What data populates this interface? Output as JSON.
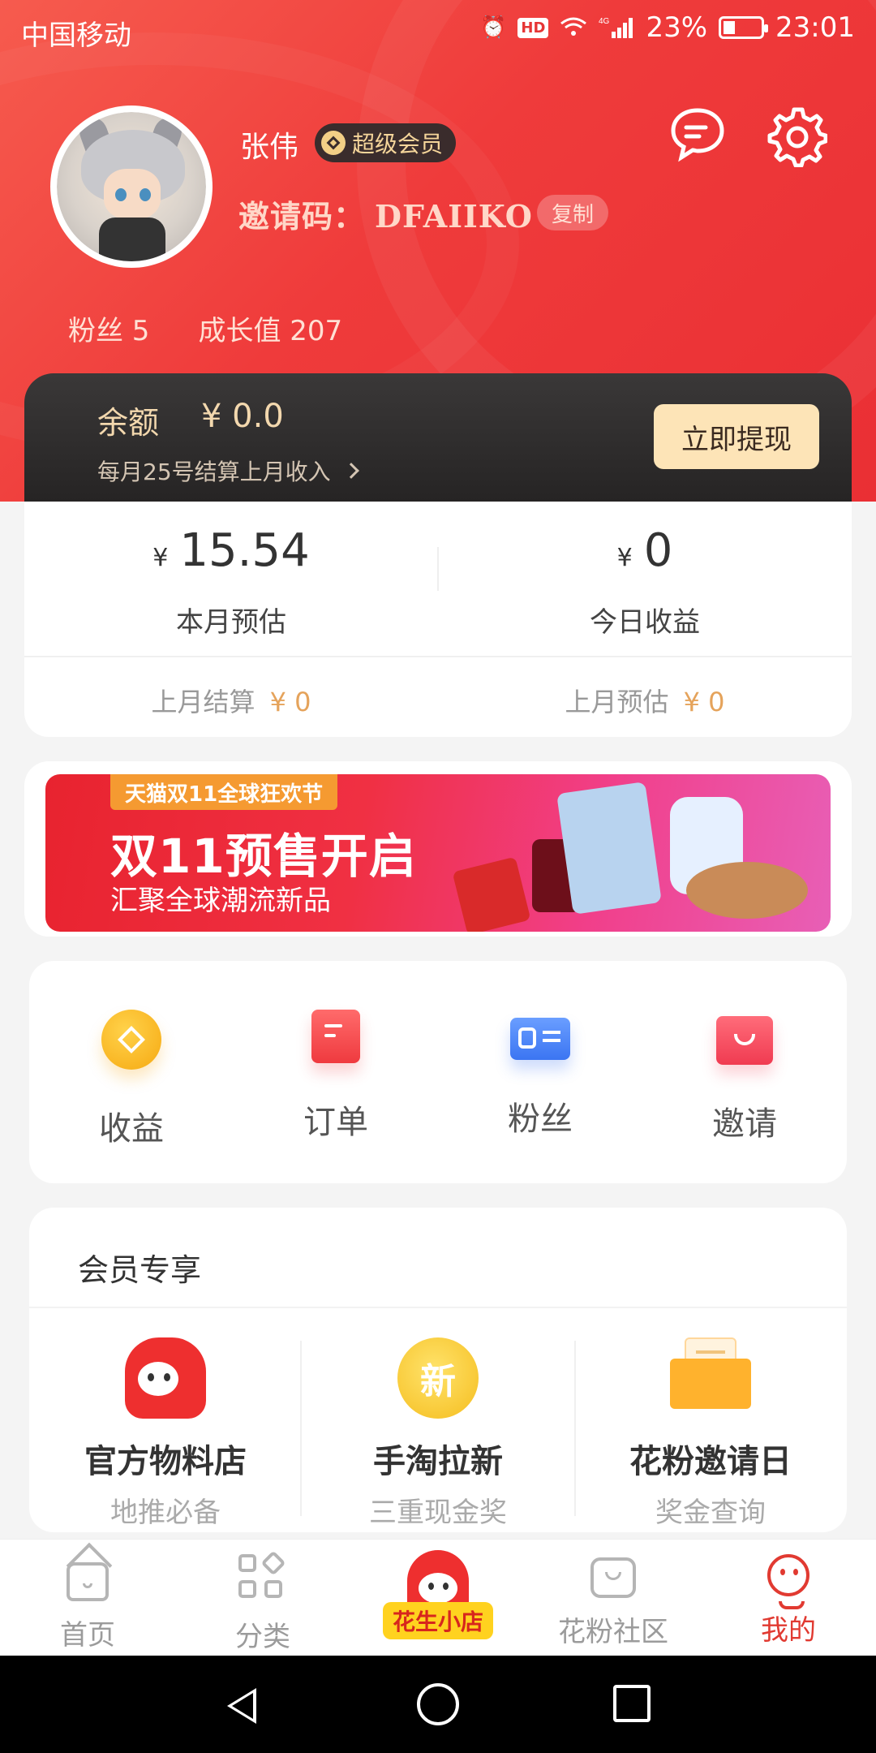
{
  "status_bar": {
    "carrier": "中国移动",
    "battery": "23%",
    "time": "23:01",
    "net": "4G",
    "hd": "HD"
  },
  "profile": {
    "name": "张伟",
    "vip_label": "超级会员",
    "invite_label": "邀请码：",
    "invite_code": "DFAIIKO",
    "copy_label": "复制",
    "fans_label": "粉丝 5",
    "growth_label": "成长值 207"
  },
  "balance": {
    "label": "余额",
    "amount": "¥ 0.0",
    "note": "每月25号结算上月收入",
    "withdraw_label": "立即提现"
  },
  "earnings": {
    "month_currency": "¥",
    "month_value": "15.54",
    "month_label": "本月预估",
    "today_currency": "¥",
    "today_value": "0",
    "today_label": "今日收益",
    "last_settle_label": "上月结算",
    "last_settle_value": "¥ 0",
    "last_est_label": "上月预估",
    "last_est_value": "¥ 0"
  },
  "banner": {
    "tag": "天猫双11全球狂欢节",
    "headline": "双11预售开启",
    "subline": "汇聚全球潮流新品"
  },
  "quick_actions": [
    {
      "label": "收益",
      "icon": "coin-icon"
    },
    {
      "label": "订单",
      "icon": "order-icon"
    },
    {
      "label": "粉丝",
      "icon": "fans-card-icon"
    },
    {
      "label": "邀请",
      "icon": "gift-icon"
    }
  ],
  "member": {
    "title": "会员专享",
    "items": [
      {
        "title": "官方物料店",
        "subtitle": "地推必备",
        "icon": "mascot-icon"
      },
      {
        "title": "手淘拉新",
        "subtitle": "三重现金奖",
        "icon_text": "新"
      },
      {
        "title": "花粉邀请日",
        "subtitle": "奖金查询",
        "icon": "mail-icon"
      }
    ]
  },
  "tabbar": {
    "items": [
      {
        "label": "首页"
      },
      {
        "label": "分类"
      },
      {
        "label": "花生小店"
      },
      {
        "label": "花粉社区"
      },
      {
        "label": "我的"
      }
    ],
    "active_color": "#e13a31"
  },
  "colors": {
    "brand_red": "#ef3b3b",
    "gold": "#f3d8ae"
  }
}
